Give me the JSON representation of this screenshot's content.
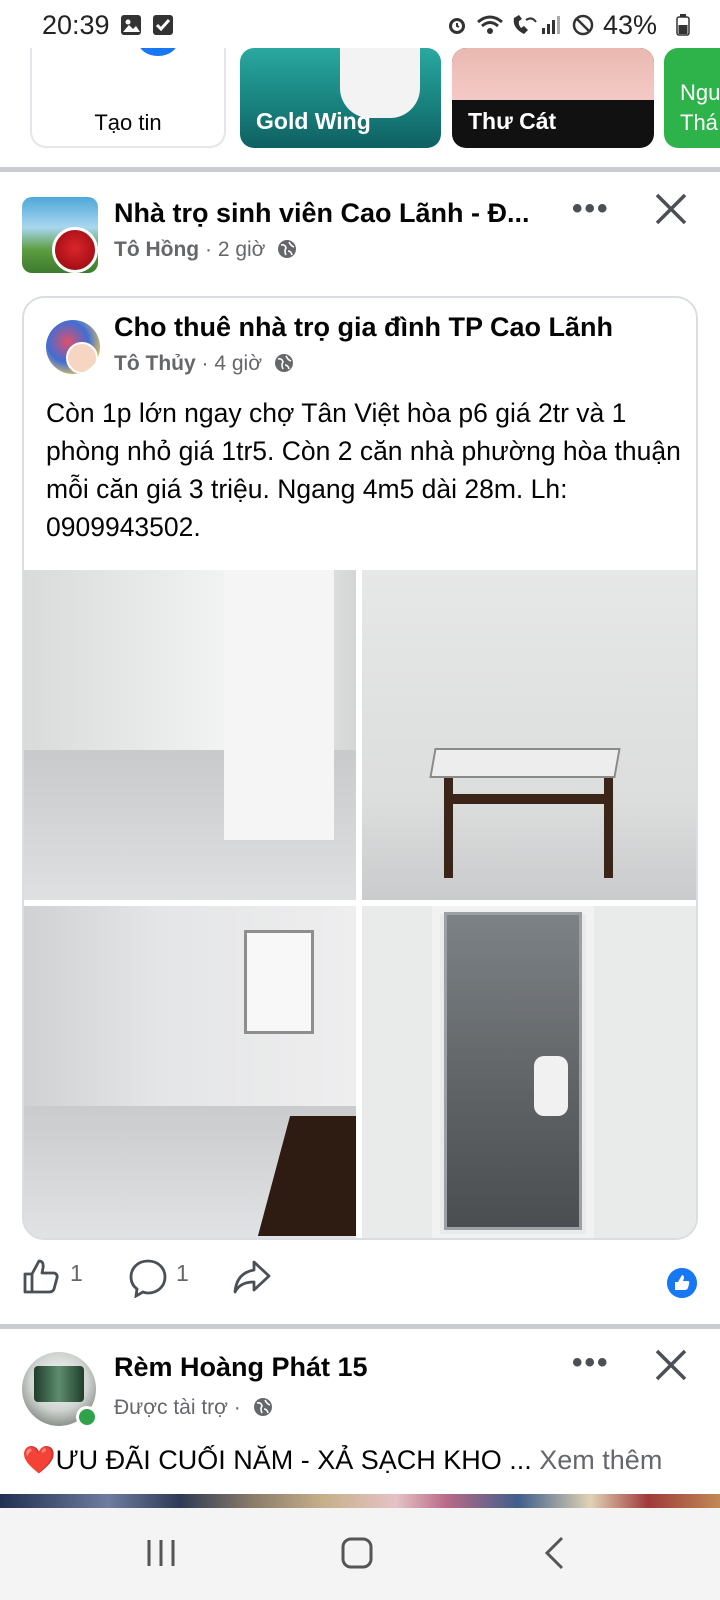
{
  "status_bar": {
    "time": "20:39",
    "battery_percent": "43%",
    "icons": [
      "gallery-icon",
      "check-icon",
      "alarm-icon",
      "wifi-icon",
      "wifi-call-icon",
      "signal-icon",
      "dnd-icon",
      "battery-icon"
    ]
  },
  "stories": [
    {
      "label": "Tạo tin"
    },
    {
      "label": "Gold Wing"
    },
    {
      "label": "Thư Cát"
    },
    {
      "label": "Ngu Thá"
    }
  ],
  "post1": {
    "group_name": "Nhà trọ sinh viên Cao Lãnh - Đ...",
    "author": "Tô Hồng",
    "time": "2 giờ",
    "shared": {
      "group_name": "Cho thuê nhà trọ gia đình TP Cao Lãnh",
      "author": "Tô Thủy",
      "time": "4 giờ",
      "text": "Còn 1p lớn ngay chợ Tân Việt hòa p6 giá 2tr và 1 phòng nhỏ giá 1tr5. Còn 2 căn nhà phường hòa thuận mỗi căn giá 3 triệu. Ngang 4m5 dài 28m. Lh: 0909943502."
    },
    "like_count": "1",
    "comment_count": "1"
  },
  "post2": {
    "page_name": "Rèm Hoàng Phát 15",
    "sponsored": "Được tài trợ",
    "text": "ƯU ĐÃI CUỐI NĂM - XẢ SẠCH KHO ...",
    "see_more": "Xem thêm",
    "heart": "❤️"
  },
  "separator": "·",
  "colors": {
    "accent": "#1877f2",
    "meta": "#65676b",
    "divider": "#c9ccd1"
  }
}
